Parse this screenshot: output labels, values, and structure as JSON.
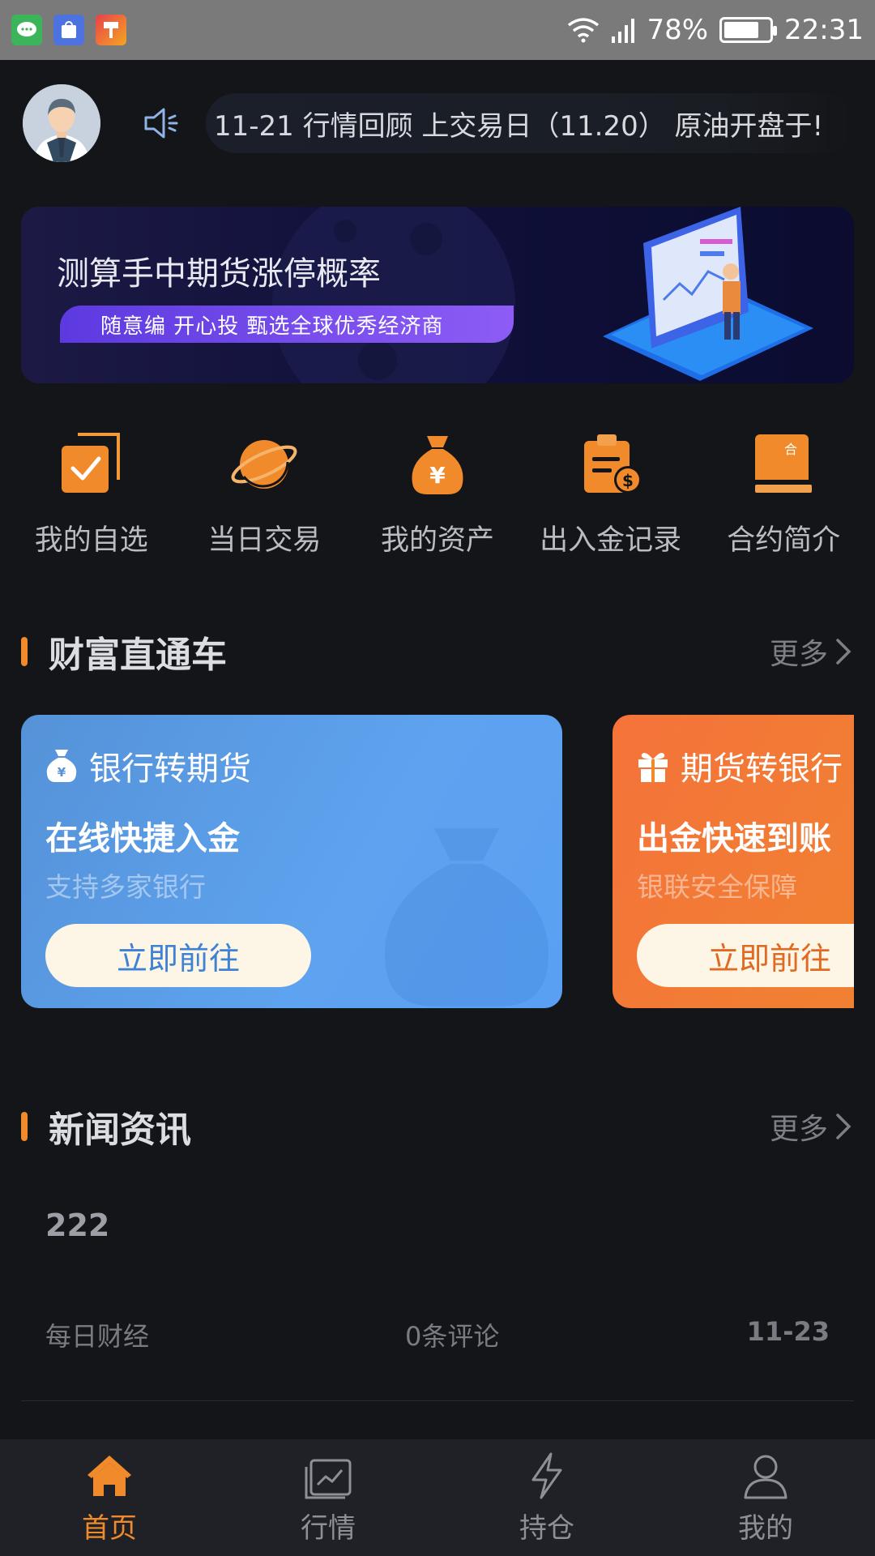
{
  "status_bar": {
    "battery": "78%",
    "time": "22:31",
    "app_icons": [
      "message-app-icon",
      "store-app-icon",
      "tool-app-icon"
    ]
  },
  "header": {
    "ticker_text": "11-21 行情回顾 上交易日（11.20） 原油开盘于!"
  },
  "banner": {
    "title": "测算手中期货涨停概率",
    "tagline": "随意编  开心投  甄选全球优秀经济商"
  },
  "shortcuts": [
    {
      "label": "我的自选",
      "icon": "checkbox-icon"
    },
    {
      "label": "当日交易",
      "icon": "planet-icon"
    },
    {
      "label": "我的资产",
      "icon": "money-bag-icon"
    },
    {
      "label": "出入金记录",
      "icon": "clipboard-dollar-icon"
    },
    {
      "label": "合约简介",
      "icon": "book-icon"
    }
  ],
  "wealth_section": {
    "title": "财富直通车",
    "more": "更多",
    "cards": [
      {
        "head": "银行转期货",
        "main": "在线快捷入金",
        "sub": "支持多家银行",
        "button": "立即前往",
        "color": "#5ea3ef"
      },
      {
        "head": "期货转银行",
        "main": "出金快速到账",
        "sub": "银联安全保障",
        "button": "立即前往",
        "color": "#ee8b2b"
      }
    ]
  },
  "news_section": {
    "title": "新闻资讯",
    "more": "更多",
    "items": [
      {
        "title": "222",
        "source": "每日财经",
        "comments": "0条评论",
        "date": "11-23"
      }
    ]
  },
  "tabbar": {
    "tabs": [
      {
        "label": "首页",
        "icon": "home-icon",
        "active": true
      },
      {
        "label": "行情",
        "icon": "chart-icon",
        "active": false
      },
      {
        "label": "持仓",
        "icon": "lightning-icon",
        "active": false
      },
      {
        "label": "我的",
        "icon": "user-icon",
        "active": false
      }
    ]
  },
  "colors": {
    "accent": "#f08a2a",
    "background": "#141518",
    "tabbar": "#1f2127"
  }
}
